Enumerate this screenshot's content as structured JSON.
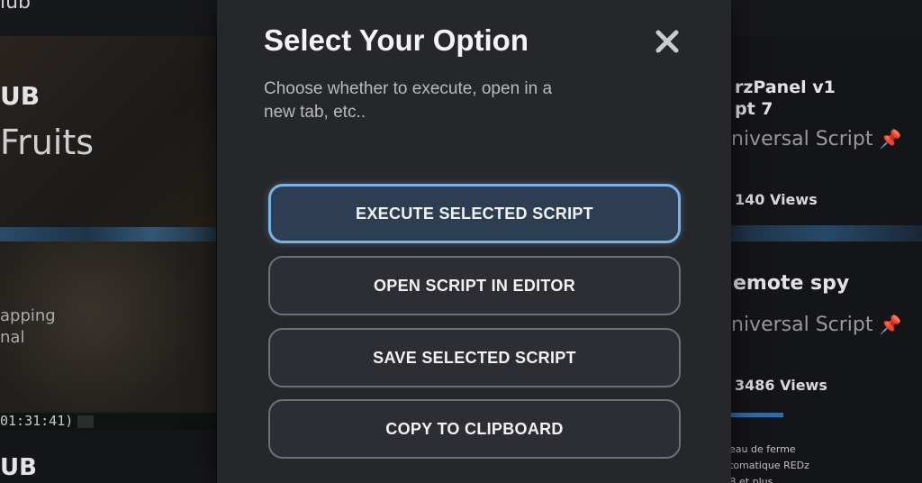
{
  "background": {
    "topbar_title": "lub",
    "left": {
      "card1_heading": "UB",
      "card1_game": "Fruits",
      "card2_line1": "apping",
      "card2_line2": "nal",
      "timestamp": "01:31:41)",
      "card3_heading": "UB"
    },
    "right": {
      "card1_title_line1": "rzPanel v1",
      "card1_title_line2": "pt 7",
      "card1_type": "niversal Script",
      "card1_views": "140 Views",
      "card2_title": "emote spy",
      "card2_type": "niversal Script",
      "card2_views": "3486 Views",
      "card3_line1": "eau de ferme",
      "card3_line2": "tomatique REDz",
      "card3_line3": "B et plus"
    },
    "pin_icon_glyph": "📌"
  },
  "modal": {
    "title": "Select Your Option",
    "description": "Choose whether to execute, open in a new tab, etc..",
    "close_icon": "close-icon",
    "options": [
      {
        "label": "EXECUTE SELECTED SCRIPT",
        "selected": true
      },
      {
        "label": "OPEN SCRIPT IN EDITOR",
        "selected": false
      },
      {
        "label": "SAVE SELECTED SCRIPT",
        "selected": false
      },
      {
        "label": "COPY TO CLIPBOARD",
        "selected": false
      }
    ]
  },
  "colors": {
    "modal_bg": "#26272b",
    "accent_border": "#7ab3e6",
    "pin": "#d64545"
  }
}
